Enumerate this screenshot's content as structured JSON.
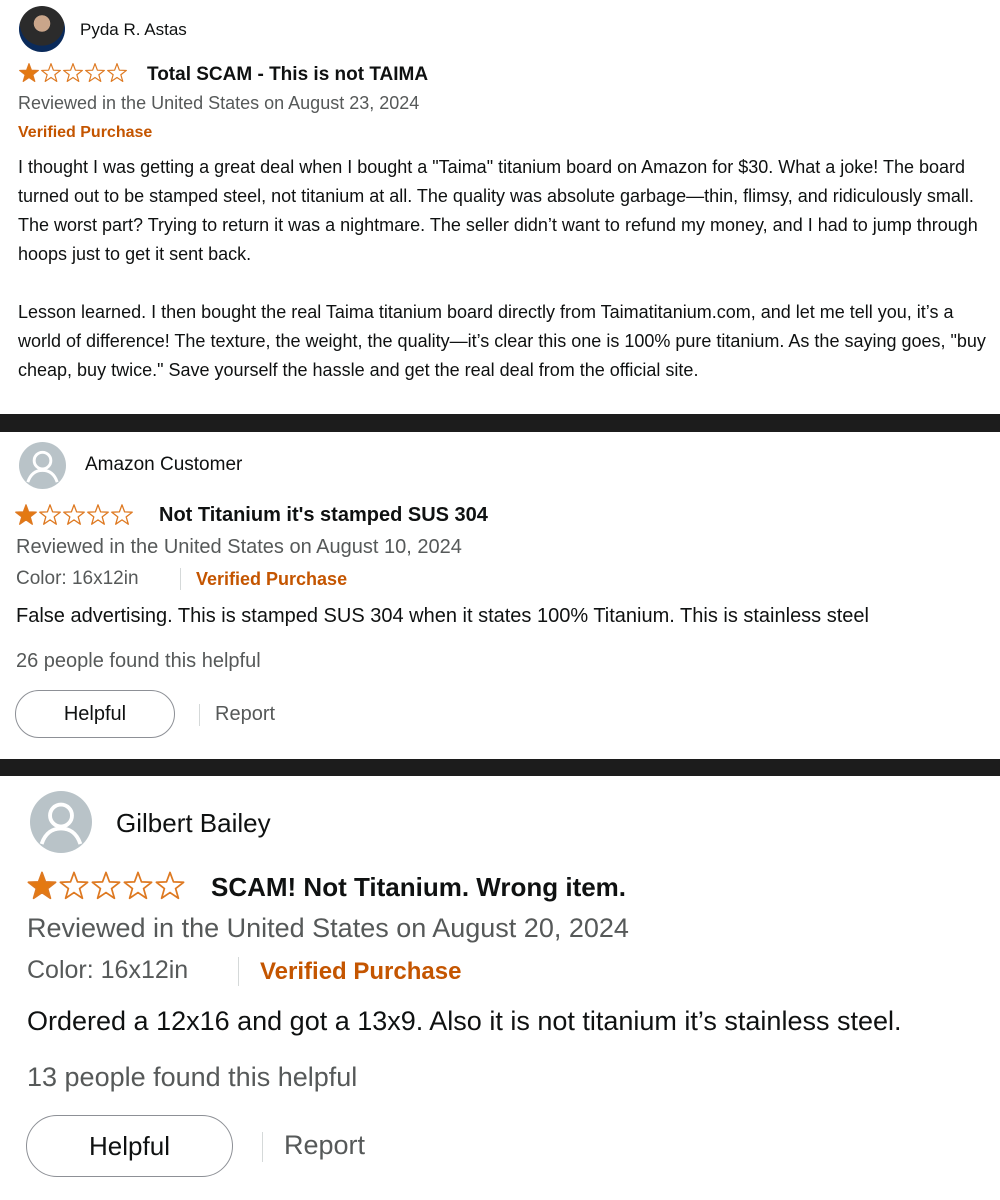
{
  "reviews": [
    {
      "reviewer": "Pyda R. Astas",
      "rating": 1,
      "rating_max": 5,
      "title": "Total SCAM - This is not TAIMA",
      "date_line": "Reviewed in the United States on August 23, 2024",
      "verified": "Verified Purchase",
      "paragraphs": [
        "I thought I was getting a great deal when I bought a \"Taima\" titanium board on Amazon for $30. What a joke! The board turned out to be stamped steel, not titanium at all. The quality was absolute garbage—thin, flimsy, and ridiculously small. The worst part? Trying to return it was a nightmare. The seller didn’t want to refund my money, and I had to jump through hoops just to get it sent back.",
        "Lesson learned. I then bought the real Taima titanium board directly from Taimatitanium.com, and let me tell you, it’s a world of difference! The texture, the weight, the quality—it’s clear this one is 100% pure titanium. As the saying goes, \"buy cheap, buy twice.\" Save yourself the hassle and get the real deal from the official site."
      ]
    },
    {
      "reviewer": "Amazon Customer",
      "rating": 1,
      "rating_max": 5,
      "title": "Not Titanium it's stamped SUS 304",
      "date_line": "Reviewed in the United States on August 10, 2024",
      "color": "Color: 16x12in",
      "verified": "Verified Purchase",
      "body": "False advertising. This is stamped SUS 304 when it states 100% Titanium. This is stainless steel",
      "helpful_count": "26 people found this helpful",
      "helpful_label": "Helpful",
      "report_label": "Report"
    },
    {
      "reviewer": "Gilbert Bailey",
      "rating": 1,
      "rating_max": 5,
      "title": "SCAM! Not Titanium. Wrong item.",
      "date_line": "Reviewed in the United States on August 20, 2024",
      "color": "Color: 16x12in",
      "verified": "Verified Purchase",
      "body": "Ordered a 12x16 and got a 13x9. Also it is not titanium it’s stainless steel.",
      "helpful_count": "13 people found this helpful",
      "helpful_label": "Helpful",
      "report_label": "Report"
    }
  ],
  "colors": {
    "star_fill": "#e47911",
    "star_outline": "#de7921",
    "verified": "#c45500",
    "secondary_text": "#565959",
    "divider": "#1c1c1c"
  }
}
